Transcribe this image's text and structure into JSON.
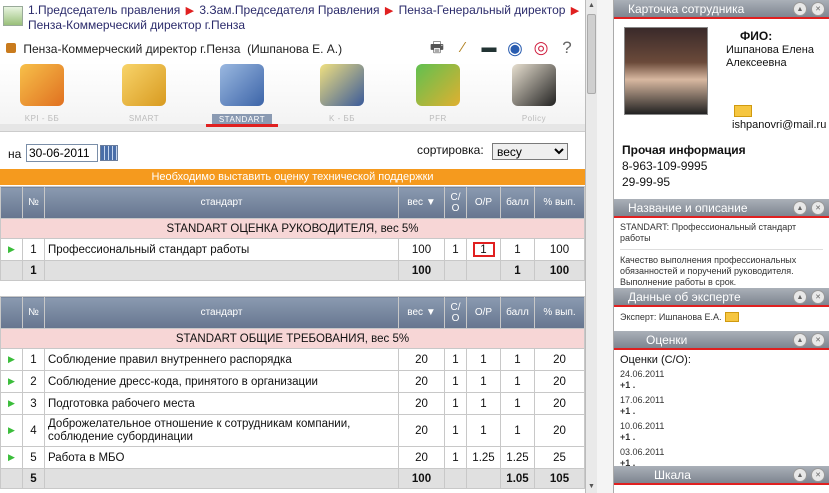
{
  "breadcrumb": {
    "items": [
      "1.Председатель правления",
      "3.Зам.Председателя Правления",
      "Пенза-Генеральный директор",
      "Пенза-Коммерческий директор г.Пенза"
    ]
  },
  "header": {
    "title": "Пенза-Коммерческий директор г.Пенза",
    "person": "(Ишпанова Е. А.)"
  },
  "modules": [
    {
      "label": "KPI - ББ",
      "icon": "kpi-icon"
    },
    {
      "label": "SMART",
      "icon": "smart-folder-icon"
    },
    {
      "label": "STANDART",
      "icon": "standart-goal-icon"
    },
    {
      "label": "K - ББ",
      "icon": "k-person-icon"
    },
    {
      "label": "PFR",
      "icon": "pfr-money-icon"
    },
    {
      "label": "Policy",
      "icon": "policy-graduation-icon"
    }
  ],
  "filters": {
    "date_label": "на",
    "date_value": "30-06-2011",
    "sort_label": "сортировка:",
    "sort_value": "весу"
  },
  "banner": "Необходимо выставить оценку технической поддержки",
  "table_headers": {
    "num": "№",
    "standard": "стандарт",
    "weight": "вес",
    "so": "С/О",
    "or": "О/Р",
    "score": "балл",
    "pct": "% вып."
  },
  "section1": {
    "title": "STANDART ОЦЕНКА РУКОВОДИТЕЛЯ, вес 5%",
    "rows": [
      {
        "num": "1",
        "name": "Профессиональный стандарт работы",
        "weight": "100",
        "so": "1",
        "or": "1",
        "score": "1",
        "pct": "100"
      }
    ],
    "total": {
      "num": "1",
      "weight": "100",
      "score": "1",
      "pct": "100"
    }
  },
  "section2": {
    "title": "STANDART ОБЩИЕ ТРЕБОВАНИЯ, вес 5%",
    "rows": [
      {
        "num": "1",
        "name": "Соблюдение правил внутреннего распорядка",
        "weight": "20",
        "so": "1",
        "or": "1",
        "score": "1",
        "pct": "20"
      },
      {
        "num": "2",
        "name": "Соблюдение дресс-кода, принятого в организации",
        "weight": "20",
        "so": "1",
        "or": "1",
        "score": "1",
        "pct": "20"
      },
      {
        "num": "3",
        "name": "Подготовка рабочего места",
        "weight": "20",
        "so": "1",
        "or": "1",
        "score": "1",
        "pct": "20"
      },
      {
        "num": "4",
        "name": "Доброжелательное отношение к сотрудникам компании, соблюдение субординации",
        "weight": "20",
        "so": "1",
        "or": "1",
        "score": "1",
        "pct": "20"
      },
      {
        "num": "5",
        "name": "Работа в МБО",
        "weight": "20",
        "so": "1",
        "or": "1.25",
        "score": "1.25",
        "pct": "25"
      }
    ],
    "total": {
      "num": "5",
      "weight": "100",
      "score": "1.05",
      "pct": "105"
    }
  },
  "right": {
    "card_title": "Карточка сотрудника",
    "fio_label": "ФИО:",
    "fio_value": "Ишпанова Елена Алексеевна",
    "email": "ishpanovri@mail.ru",
    "other_title": "Прочая информация",
    "phone1": "8-963-109-9995",
    "phone2": "29-99-95",
    "desc_title": "Название и описание",
    "desc_line1": "STANDART: Профессиональный стандарт работы",
    "desc_line2": "Качество выполнения профессиональных обязанностей и поручений руководителя. Выполнение работы в срок.",
    "expert_title": "Данные об эксперте",
    "expert_value": "Эксперт: Ишпанова Е.А.",
    "ratings_title": "Оценки",
    "ratings_label": "Оценки (С/О):",
    "ratings": [
      {
        "date": "24.06.2011",
        "value": "+1 ."
      },
      {
        "date": "17.06.2011",
        "value": "+1 ."
      },
      {
        "date": "10.06.2011",
        "value": "+1 ."
      },
      {
        "date": "03.06.2011",
        "value": "+1 ."
      }
    ],
    "scale_title": "Шкала"
  }
}
